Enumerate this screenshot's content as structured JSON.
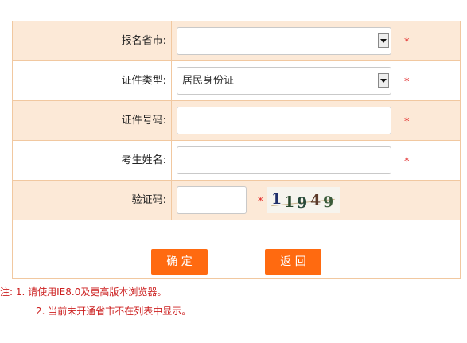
{
  "form": {
    "province": {
      "label": "报名省市:",
      "value": ""
    },
    "id_type": {
      "label": "证件类型:",
      "value": "居民身份证"
    },
    "id_number": {
      "label": "证件号码:",
      "value": ""
    },
    "name": {
      "label": "考生姓名:",
      "value": ""
    },
    "captcha": {
      "label": "验证码:",
      "value": "",
      "image_text": [
        "1",
        "1",
        "9",
        "4",
        "9"
      ]
    },
    "required_mark": "*"
  },
  "buttons": {
    "confirm": "确 定",
    "back": "返 回"
  },
  "notes": {
    "line1": "注: 1. 请使用IE8.0及更高版本浏览器。",
    "line2": "2. 当前未开通省市不在列表中显示。"
  },
  "colors": {
    "row_shade": "#fce9d7",
    "border": "#f1c8a0",
    "button": "#ff6a10",
    "required": "#e02020",
    "note_text": "#cc1f1f"
  },
  "icons": {
    "dropdown": "chevron-down-icon"
  }
}
